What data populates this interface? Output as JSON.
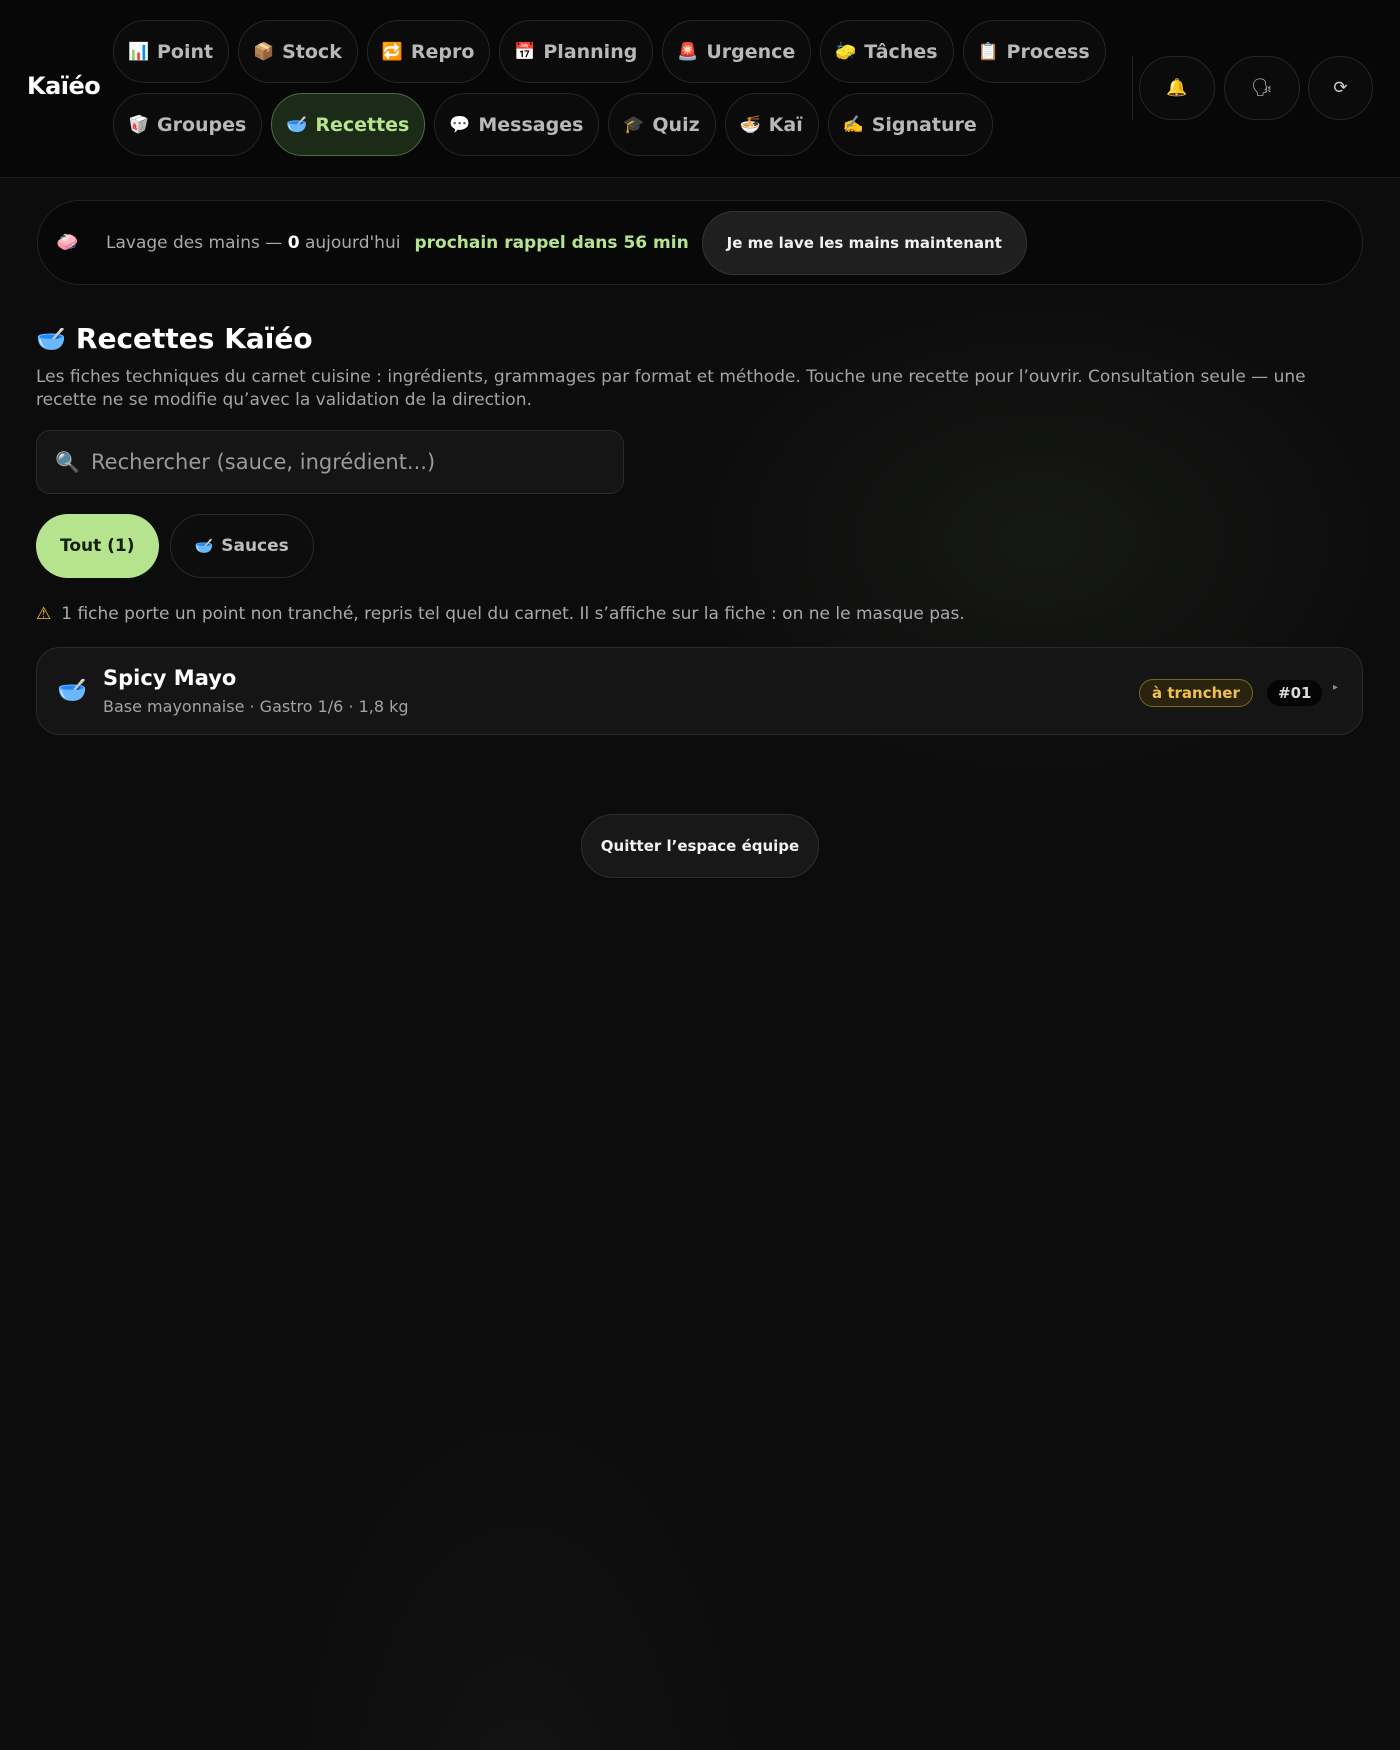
{
  "app": {
    "logo": "Kaïéo"
  },
  "nav": {
    "row1": [
      {
        "icon": "📊",
        "label": "Point",
        "name": "point"
      },
      {
        "icon": "📦",
        "label": "Stock",
        "name": "stock"
      },
      {
        "icon": "🔁",
        "label": "Repro",
        "name": "repro"
      },
      {
        "icon": "📅",
        "label": "Planning",
        "name": "planning"
      },
      {
        "icon": "🚨",
        "label": "Urgence",
        "name": "urgence"
      },
      {
        "icon": "🧽",
        "label": "Tâches",
        "name": "taches"
      },
      {
        "icon": "📋",
        "label": "Process",
        "name": "process"
      }
    ],
    "row2": [
      {
        "icon": "🥡",
        "label": "Groupes",
        "name": "groupes"
      },
      {
        "icon": "🥣",
        "label": "Recettes",
        "name": "recettes",
        "active": true
      },
      {
        "icon": "💬",
        "label": "Messages",
        "name": "messages"
      },
      {
        "icon": "🎓",
        "label": "Quiz",
        "name": "quiz"
      },
      {
        "icon": "🍜",
        "label": "Kaï",
        "name": "kai"
      },
      {
        "icon": "✍️",
        "label": "Signature",
        "name": "signature"
      }
    ],
    "actions": {
      "notifications_icon": "🔔",
      "voice_icon": "🗣",
      "refresh_icon": "⟳"
    }
  },
  "handwash": {
    "icon": "🧼",
    "label": "Lavage des mains —",
    "count": "0",
    "count_suffix": "aujourd'hui",
    "next_reminder": "prochain rappel dans 56 min",
    "button_label": "Je me lave les mains maintenant"
  },
  "page": {
    "title_icon": "🥣",
    "title": "Recettes Kaïéo",
    "description": "Les fiches techniques du carnet cuisine : ingrédients, grammages par format et méthode. Touche une recette pour l’ouvrir. Consultation seule — une recette ne se modifie qu’avec la validation de la direction."
  },
  "search": {
    "icon": "🔍",
    "placeholder": "Rechercher (sauce, ingrédient...)",
    "value": ""
  },
  "filters": [
    {
      "label": "Tout (1)",
      "active": true
    },
    {
      "icon": "🥣",
      "label": "Sauces",
      "active": false
    }
  ],
  "warning": {
    "icon": "⚠",
    "text": "1 fiche porte un point non tranché, repris tel quel du carnet. Il s’affiche sur la fiche : on ne le masque pas."
  },
  "recipes": [
    {
      "icon": "🥣",
      "name": "Spicy Mayo",
      "meta": "Base mayonnaise · Gastro 1/6 · 1,8 kg",
      "badge": "à trancher",
      "number": "#01",
      "chevron": "▸"
    }
  ],
  "footer": {
    "quit_label": "Quitter l’espace équipe"
  },
  "colors": {
    "accent": "#b6e48e",
    "warning": "#f0c14e",
    "background": "#0c0c0c"
  }
}
